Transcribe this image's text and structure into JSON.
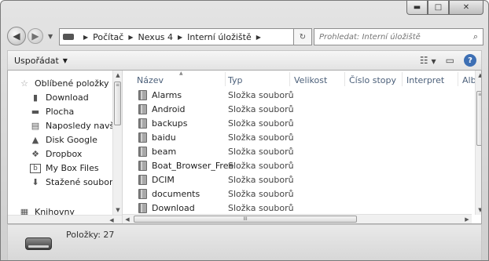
{
  "window": {
    "caption_buttons": [
      "minimize",
      "maximize",
      "close"
    ]
  },
  "breadcrumb": [
    "Počítač",
    "Nexus 4",
    "Interní úložiště"
  ],
  "search": {
    "placeholder": "Prohledat: Interní úložiště"
  },
  "toolbar": {
    "organize_label": "Uspořádat"
  },
  "nav": {
    "favorites_label": "Oblíbené položky",
    "items": [
      {
        "label": "Download",
        "icon": "folder-icon"
      },
      {
        "label": "Plocha",
        "icon": "desktop-icon"
      },
      {
        "label": "Naposledy navští",
        "icon": "recent-places-icon"
      },
      {
        "label": "Disk Google",
        "icon": "google-drive-icon"
      },
      {
        "label": "Dropbox",
        "icon": "dropbox-icon"
      },
      {
        "label": "My Box Files",
        "icon": "box-icon"
      },
      {
        "label": "Stažené soubory",
        "icon": "downloads-icon"
      }
    ],
    "libraries_label": "Knihovny"
  },
  "columns": [
    "Název",
    "Typ",
    "Velikost",
    "Číslo stopy",
    "Interpret",
    "Alb"
  ],
  "rows": [
    {
      "name": "Alarms",
      "type": "Složka souborů"
    },
    {
      "name": "Android",
      "type": "Složka souborů"
    },
    {
      "name": "backups",
      "type": "Složka souborů"
    },
    {
      "name": "baidu",
      "type": "Složka souborů"
    },
    {
      "name": "beam",
      "type": "Složka souborů"
    },
    {
      "name": "Boat_Browser_Free",
      "type": "Složka souborů"
    },
    {
      "name": "DCIM",
      "type": "Složka souborů"
    },
    {
      "name": "documents",
      "type": "Složka souborů"
    },
    {
      "name": "Download",
      "type": "Složka souborů"
    }
  ],
  "status": {
    "items_text": "Položky: 27"
  }
}
